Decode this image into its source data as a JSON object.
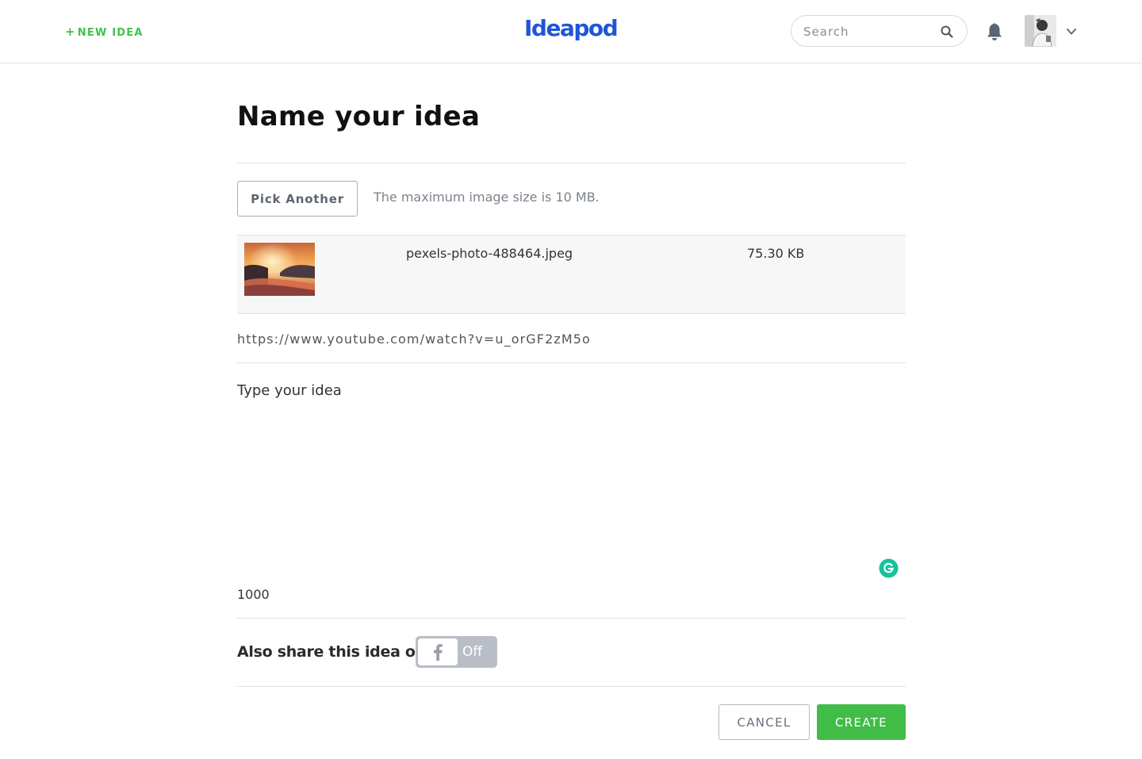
{
  "header": {
    "new_idea_plus": "+",
    "new_idea_label": "NEW IDEA",
    "logo": "Ideapod",
    "search_placeholder": "Search",
    "accent_color": "#3ec34a",
    "logo_color": "#1f56d6"
  },
  "form": {
    "title": "Name your idea",
    "pick_button": "Pick Another",
    "max_size_note": "The maximum image size is 10 MB.",
    "file": {
      "name": "pexels-photo-488464.jpeg",
      "size": "75.30 KB"
    },
    "url": "https://www.youtube.com/watch?v=u_orGF2zM5o",
    "idea_placeholder": "Type your idea",
    "char_count": "1000",
    "share_label": "Also share this idea on",
    "facebook_toggle_state": "Off",
    "cancel_button": "CANCEL",
    "create_button": "CREATE",
    "create_color": "#41bd47"
  },
  "icons": {
    "search": "search-icon",
    "bell": "bell-icon",
    "chevron": "chevron-down-icon",
    "grammarly": "grammarly-icon",
    "facebook": "facebook-icon"
  }
}
